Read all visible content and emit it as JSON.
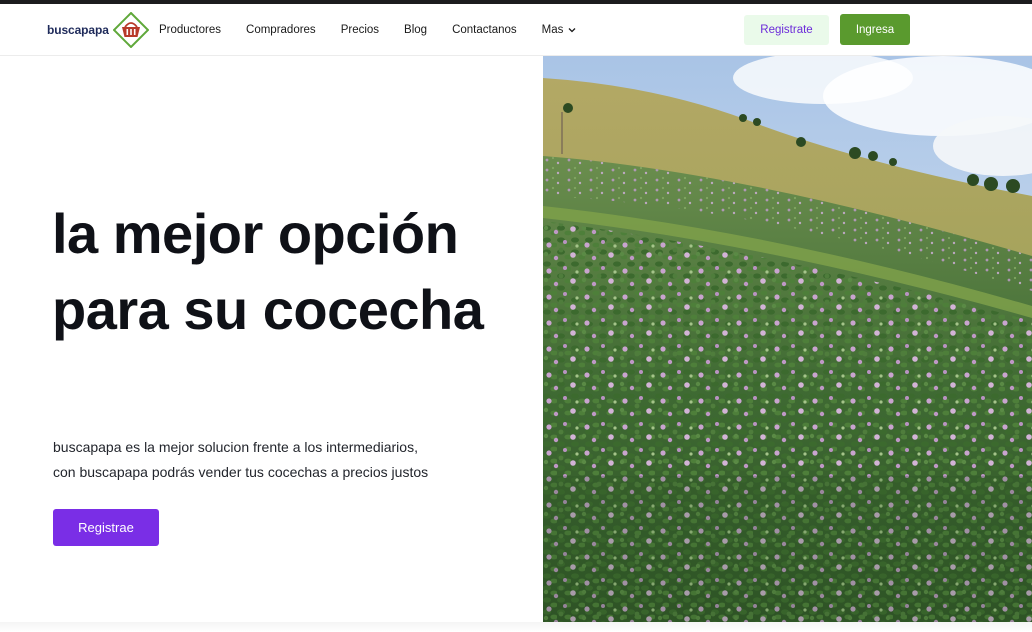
{
  "brand": {
    "name": "buscapapa",
    "logo_icon": "basket-diamond-icon",
    "colors": {
      "diamond_border": "#5fa83a",
      "basket": "#b83a2a",
      "text": "#1e2a5a"
    }
  },
  "nav": {
    "items": [
      {
        "label": "Productores"
      },
      {
        "label": "Compradores"
      },
      {
        "label": "Precios"
      },
      {
        "label": "Blog"
      },
      {
        "label": "Contactanos"
      },
      {
        "label": "Mas",
        "icon": "chevron-down-icon"
      }
    ],
    "register_label": "Registrate",
    "login_label": "Ingresa"
  },
  "hero": {
    "title": "la mejor opción para su cocecha",
    "subtitle_line1": "buscapapa es la mejor solucion frente a los intermediarios,",
    "subtitle_line2": "con buscapapa podrás vender tus cocechas a precios justos",
    "cta_label": "Registrae",
    "image": "potato-flower-field-hillside-photo"
  },
  "colors": {
    "cta_purple": "#7a2ee6",
    "login_green": "#5a9a2e",
    "register_bg": "#eafaea",
    "register_text": "#6c2bd9"
  }
}
